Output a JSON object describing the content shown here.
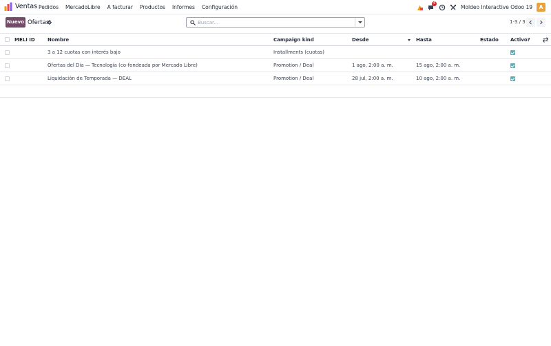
{
  "app": {
    "name": "Ventas"
  },
  "menu": [
    "Pedidos",
    "MercadoLibre",
    "A facturar",
    "Productos",
    "Informes",
    "Configuración"
  ],
  "navbar": {
    "chat_count": "4",
    "company": "Moldeo Interactive Odoo 19",
    "avatar_letter": "A"
  },
  "control": {
    "new_label": "Nuevo",
    "breadcrumb": "Ofertas",
    "search_placeholder": "Buscar...",
    "pager": "1-3 / 3"
  },
  "table": {
    "columns": {
      "meli_id": "MELI ID",
      "nombre": "Nombre",
      "campaign_kind": "Campaign kind",
      "desde": "Desde",
      "hasta": "Hasta",
      "estado": "Estado",
      "activo": "Activo?"
    },
    "rows": [
      {
        "meli_id": "",
        "nombre": "3 a 12 cuotas con interés bajo",
        "campaign_kind": "Installments (cuotas)",
        "desde": "",
        "hasta": "",
        "estado": "",
        "activo": true
      },
      {
        "meli_id": "",
        "nombre": "Ofertas del Día — Tecnología (co-fondeada por Mercado Libre)",
        "campaign_kind": "Promotion / Deal",
        "desde": "1 ago, 2:00 a. m.",
        "hasta": "15 ago, 2:00 a. m.",
        "estado": "",
        "activo": true
      },
      {
        "meli_id": "",
        "nombre": "Liquidación de Temporada — DEAL",
        "campaign_kind": "Promotion / Deal",
        "desde": "28 jul, 2:00 a. m.",
        "hasta": "10 ago, 2:00 a. m.",
        "estado": "",
        "activo": true
      }
    ]
  },
  "colors": {
    "brand": "#714b67",
    "active_check": "#5bb1b6",
    "badge": "#dc2626",
    "avatar": "#e8a33d"
  },
  "icons": [
    "sales-app-icon",
    "activity-icon",
    "chat-icon",
    "clock-icon",
    "tools-icon",
    "gear-icon",
    "search-icon",
    "chevron-left-icon",
    "chevron-right-icon",
    "column-options-icon"
  ]
}
